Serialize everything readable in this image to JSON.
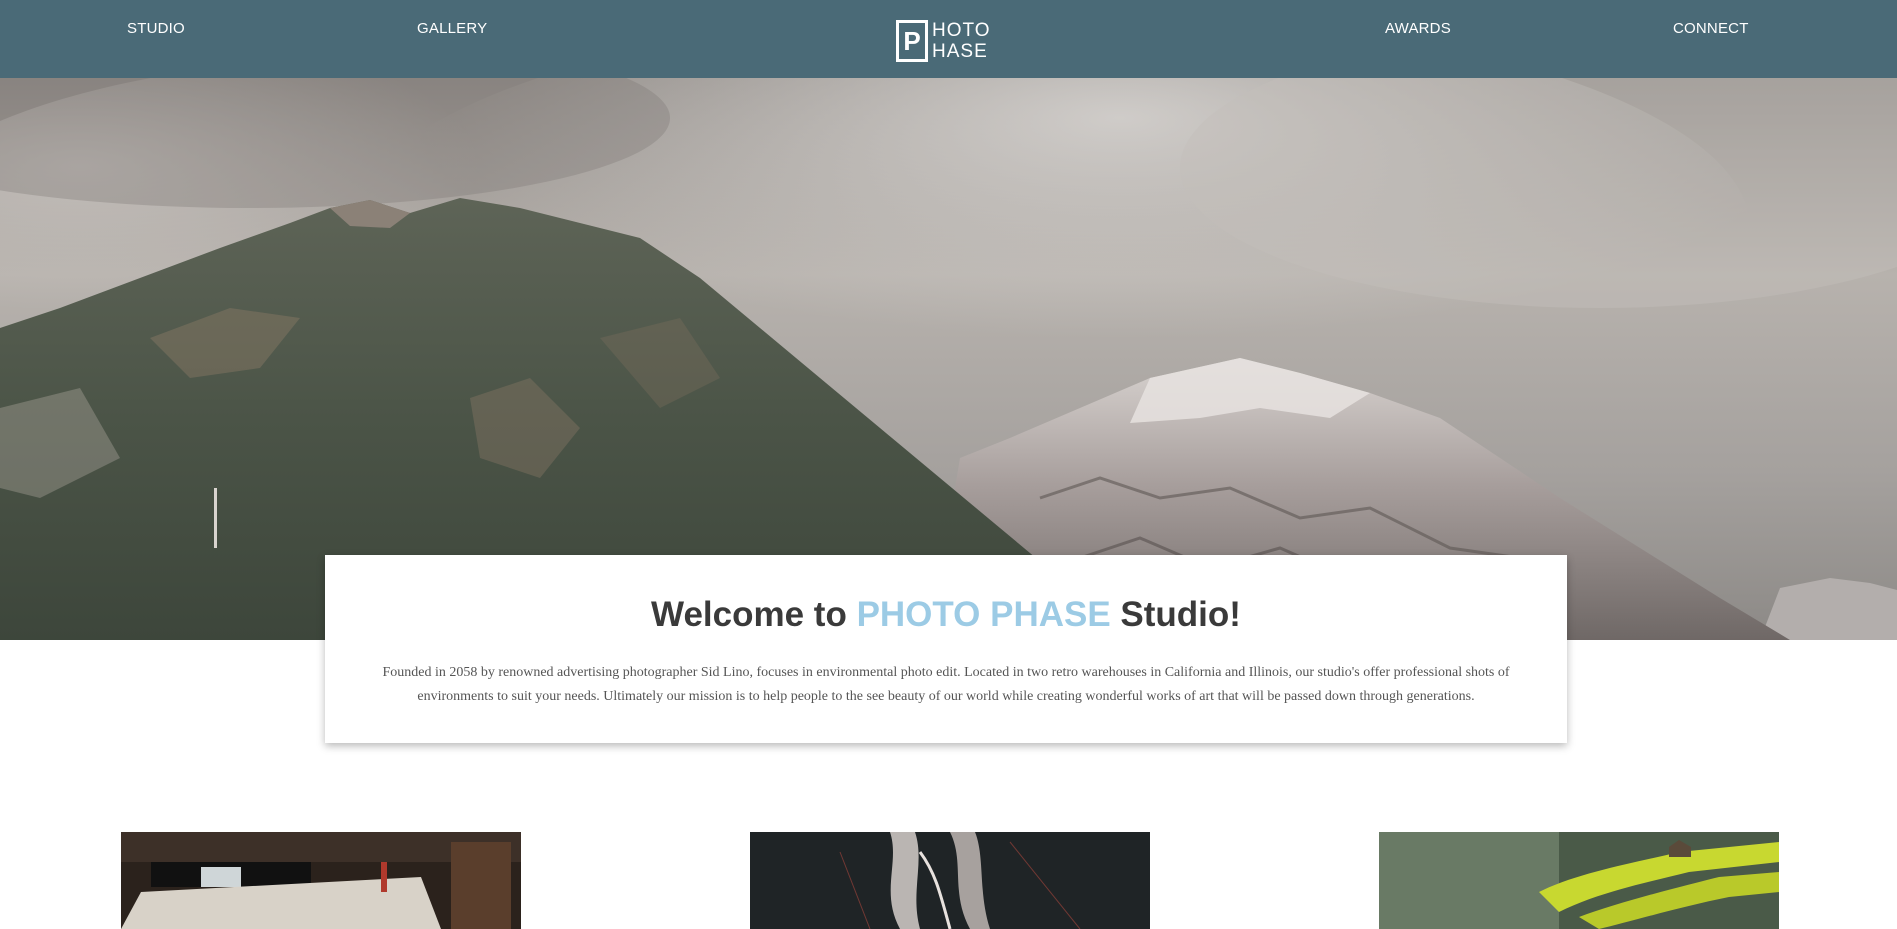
{
  "nav": {
    "links": [
      {
        "label": "STUDIO"
      },
      {
        "label": "GALLERY"
      },
      {
        "label": "AWARDS"
      },
      {
        "label": "CONNECT"
      }
    ],
    "logo": {
      "box_letter": "P",
      "line1": "HOTO",
      "line2": "HASE"
    }
  },
  "welcome": {
    "title_prefix": "Welcome to ",
    "title_brand": "PHOTO PHASE",
    "title_suffix": " Studio!",
    "description": "Founded in 2058 by renowned advertising photographer Sid Lino, focuses in environmental photo edit. Located in two retro warehouses in California and Illinois, our studio's offer professional shots of environments to suit your needs. Ultimately our mission is to help people to the see beauty of our world while creating wonderful works of art that will be passed down through generations."
  },
  "colors": {
    "nav_bg": "#4a6a77",
    "brand_accent": "#9ccbe5",
    "title_text": "#3a3a3a"
  }
}
